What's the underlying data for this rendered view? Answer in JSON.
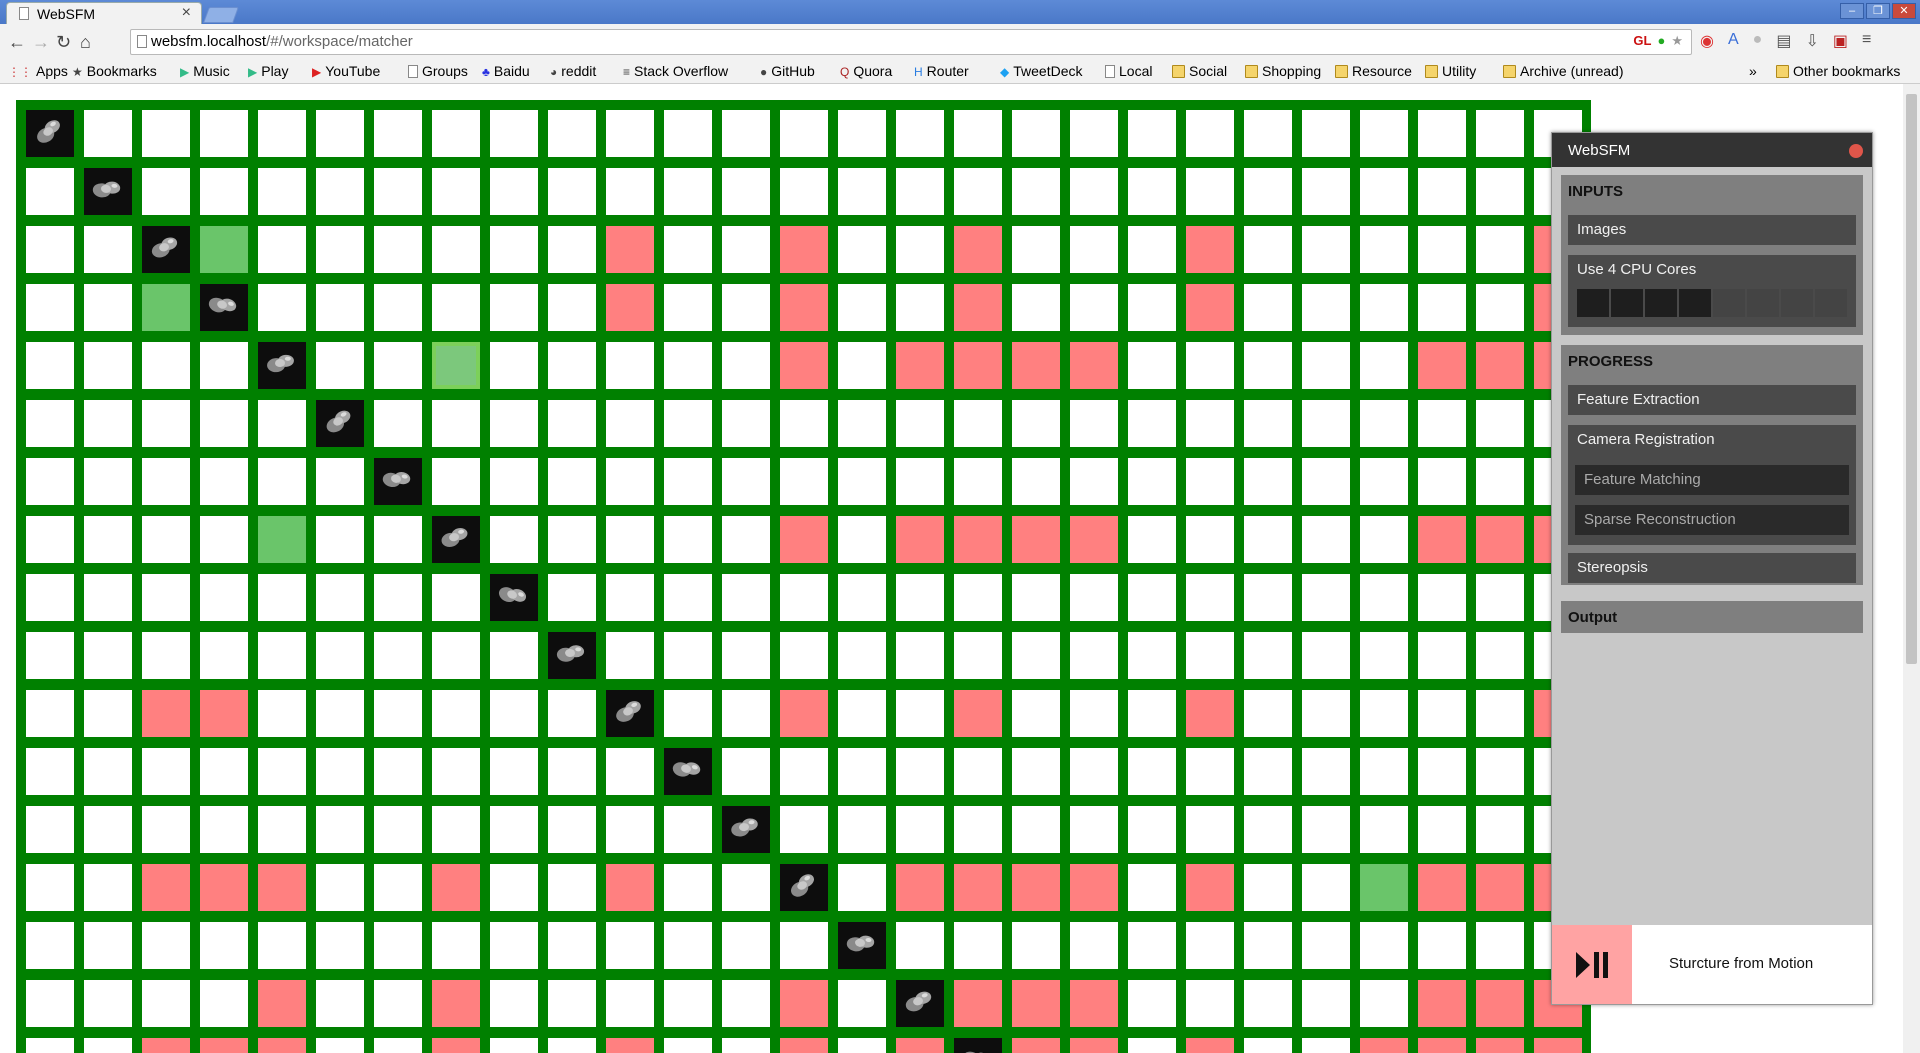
{
  "browser": {
    "tab_title": "WebSFM",
    "url_host": "websfm.localhost",
    "url_path": "/#/workspace/matcher",
    "bookmarks": [
      {
        "label": "Apps",
        "icon": "apps-grid-icon"
      },
      {
        "label": "Bookmarks",
        "icon": "star-icon"
      },
      {
        "label": "Music",
        "icon": "play-icon"
      },
      {
        "label": "Play",
        "icon": "play-icon"
      },
      {
        "label": "YouTube",
        "icon": "youtube-icon"
      },
      {
        "label": "Groups",
        "icon": "page-icon"
      },
      {
        "label": "Baidu",
        "icon": "baidu-icon"
      },
      {
        "label": "reddit",
        "icon": "reddit-icon"
      },
      {
        "label": "Stack Overflow",
        "icon": "stackoverflow-icon"
      },
      {
        "label": "GitHub",
        "icon": "github-icon"
      },
      {
        "label": "Quora",
        "icon": "quora-icon"
      },
      {
        "label": "Router",
        "icon": "router-icon"
      },
      {
        "label": "TweetDeck",
        "icon": "tweetdeck-icon"
      },
      {
        "label": "Local",
        "icon": "page-icon"
      },
      {
        "label": "Social",
        "icon": "folder-icon"
      },
      {
        "label": "Shopping",
        "icon": "folder-icon"
      },
      {
        "label": "Resource",
        "icon": "folder-icon"
      },
      {
        "label": "Utility",
        "icon": "folder-icon"
      },
      {
        "label": "Archive (unread)",
        "icon": "folder-icon"
      }
    ],
    "overflow": "»",
    "other_bookmarks": "Other bookmarks"
  },
  "matrix": {
    "colors": {
      "grid": "#008000",
      "empty": "#ffffff",
      "unmatched": "#ff8080",
      "matched": "#6ac56a",
      "image": "#0d0d0d"
    },
    "rows": [
      "I..........................",
      ".I.........................",
      "..IG......R..R..R...R.....R",
      "..GI......R..R..R...R.....R",
      "....I..S.....R.RRRR.....RRR",
      ".....I.....................",
      "......I....................",
      "....G..I.....R.RRRR.....RRR",
      "........I..................",
      ".........I.................",
      "..RR......I..R..R...R.....R",
      "...........I...............",
      "............I..............",
      "..RRR..R..R..I.RRRR.R..GRRR",
      "..............I............",
      "....R..R.....R.IRRR.....RRR",
      "..RRR..R..R..R.RIRR.R..RRRR"
    ]
  },
  "panel": {
    "title": "WebSFM",
    "inputs": {
      "title": "INPUTS",
      "images_label": "Images",
      "cpu_label": "Use 4 CPU Cores",
      "cores_total": 8,
      "cores_selected": 4
    },
    "progress": {
      "title": "PROGRESS",
      "feature_extraction": "Feature Extraction",
      "camera_registration": "Camera Registration",
      "feature_matching": "Feature Matching",
      "sparse_reconstruction": "Sparse Reconstruction",
      "stereopsis": "Stereopsis"
    },
    "output": {
      "title": "Output"
    },
    "footer_label": "Sturcture from Motion"
  }
}
